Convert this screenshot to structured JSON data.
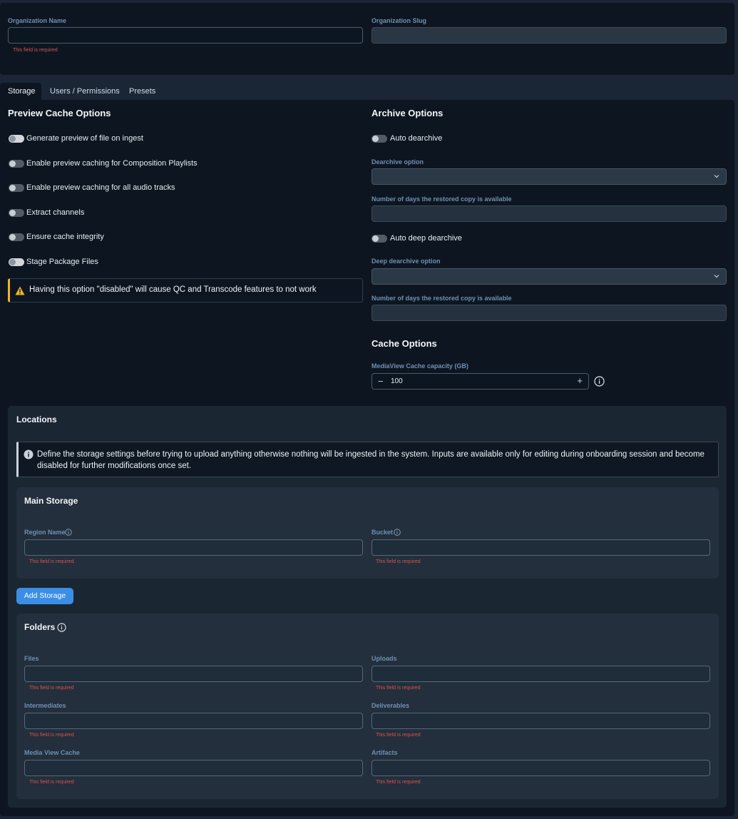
{
  "org": {
    "name_label": "Organization Name",
    "name_value": "",
    "name_error": "This field is required",
    "slug_label": "Organization Slug",
    "slug_value": ""
  },
  "tabs": [
    "Storage",
    "Users / Permissions",
    "Presets"
  ],
  "preview": {
    "title": "Preview Cache Options",
    "toggles": [
      {
        "label": "Generate preview of file on ingest",
        "on": true
      },
      {
        "label": "Enable preview caching for Composition Playlists",
        "on": false
      },
      {
        "label": "Enable preview caching for all audio tracks",
        "on": false
      },
      {
        "label": "Extract channels",
        "on": false
      },
      {
        "label": "Ensure cache integrity",
        "on": false
      },
      {
        "label": "Stage Package Files",
        "on": true
      }
    ],
    "warning": "Having this option \"disabled\" will cause QC and Transcode features to not work"
  },
  "archive": {
    "title": "Archive Options",
    "auto_dearchive": "Auto dearchive",
    "dearchive_option_label": "Dearchive option",
    "days_label_1": "Number of days the restored copy is available",
    "auto_deep_dearchive": "Auto deep dearchive",
    "deep_dearchive_option_label": "Deep dearchive option",
    "days_label_2": "Number of days the restored copy is available"
  },
  "cache": {
    "title": "Cache Options",
    "capacity_label": "MediaView Cache capacity (GB)",
    "capacity_value": "100",
    "minus": "−",
    "plus": "+"
  },
  "locations": {
    "title": "Locations",
    "info": "Define the storage settings before trying to upload anything otherwise nothing will be ingested in the system. Inputs are available only for editing during onboarding session and become disabled for further modifications once set.",
    "main_storage": {
      "title": "Main Storage",
      "region_label": "Region Name",
      "bucket_label": "Bucket",
      "error": "This field is required"
    },
    "add_storage": "Add Storage",
    "folders": {
      "title": "Folders",
      "files": "Files",
      "uploads": "Uploads",
      "intermediates": "Intermediates",
      "deliverables": "Deliverables",
      "media_view_cache": "Media View Cache",
      "artifacts": "Artifacts",
      "error": "This field is required"
    }
  },
  "colors": {
    "accent": "#3a8ee6",
    "error": "#d9534f",
    "warning": "#f0b429",
    "label": "#6f8fb4"
  }
}
